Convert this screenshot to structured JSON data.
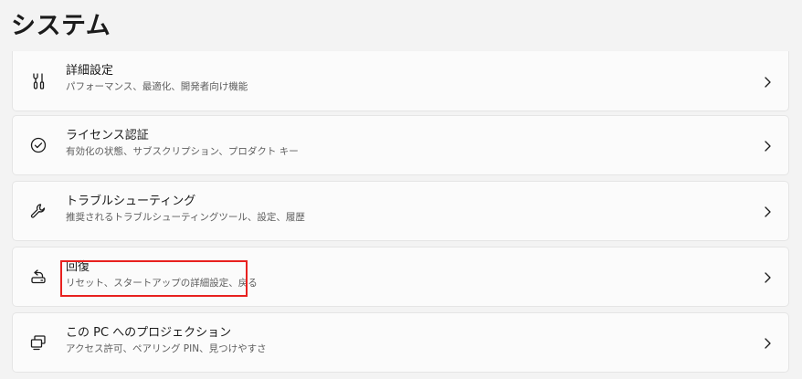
{
  "page": {
    "title": "システム"
  },
  "settings": [
    {
      "title": "詳細設定",
      "subtitle": "パフォーマンス、最適化、開発者向け機能",
      "icon": "tools-icon"
    },
    {
      "title": "ライセンス認証",
      "subtitle": "有効化の状態、サブスクリプション、プロダクト キー",
      "icon": "check-circle-icon"
    },
    {
      "title": "トラブルシューティング",
      "subtitle": "推奨されるトラブルシューティングツール、設定、履歴",
      "icon": "wrench-icon"
    },
    {
      "title": "回復",
      "subtitle": "リセット、スタートアップの詳細設定、戻る",
      "icon": "recovery-icon",
      "highlighted": true
    },
    {
      "title": "この PC へのプロジェクション",
      "subtitle": "アクセス許可、ペアリング PIN、見つけやすさ",
      "icon": "projection-icon"
    }
  ],
  "colors": {
    "background": "#f3f3f3",
    "card": "#fbfbfb",
    "highlight": "#e8211f"
  }
}
